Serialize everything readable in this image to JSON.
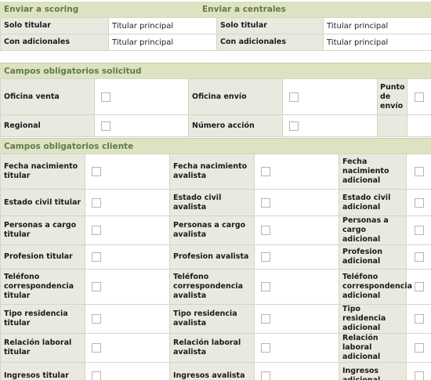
{
  "scoring": {
    "left_title": "Enviar a scoring",
    "right_title": "Enviar a centrales",
    "rows": [
      {
        "label_left": "Solo titular",
        "value_left": "Titular principal",
        "label_right": "Solo titular",
        "value_right": "Titular principal"
      },
      {
        "label_left": "Con adicionales",
        "value_left": "Titular principal",
        "label_right": "Con adicionales",
        "value_right": "Titular principal"
      }
    ]
  },
  "solicitud": {
    "title": "Campos obligatorios solicitud",
    "rows": [
      {
        "c1": "Oficina venta",
        "c2": "Oficina envío",
        "c3": "Punto de envío"
      },
      {
        "c1": "Regional",
        "c2": "Número acción",
        "c3": ""
      }
    ]
  },
  "cliente": {
    "title": "Campos obligatorios cliente",
    "rows": [
      {
        "c1": "Fecha nacimiento titular",
        "c2": "Fecha nacimiento avalista",
        "c3": "Fecha nacimiento adicional"
      },
      {
        "c1": "Estado civil titular",
        "c2": "Estado civil avalista",
        "c3": "Estado civil adicional"
      },
      {
        "c1": "Personas a cargo titular",
        "c2": "Personas a cargo avalista",
        "c3": "Personas a cargo adicional"
      },
      {
        "c1": "Profesion titular",
        "c2": "Profesion avalista",
        "c3": "Profesion adicional"
      },
      {
        "c1": "Teléfono correspondencia titular",
        "c2": "Teléfono correspondencia avalista",
        "c3": "Teléfono correspondencia adicional"
      },
      {
        "c1": "Tipo residencia titular",
        "c2": "Tipo residencia avalista",
        "c3": "Tipo residencia adicional"
      },
      {
        "c1": "Relación laboral titular",
        "c2": "Relación laboral avalista",
        "c3": "Relación laboral adicional"
      },
      {
        "c1": "Ingresos titular",
        "c2": "Ingresos avalista",
        "c3": "Ingresos adicional"
      }
    ]
  }
}
